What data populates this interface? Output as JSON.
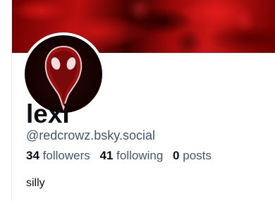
{
  "profile": {
    "display_name": "lexi",
    "handle": "@redcrowz.bsky.social",
    "bio": "silly",
    "avatar_icon": "plague-mask-avatar",
    "banner_icon": "red-smoke-banner"
  },
  "stats": {
    "followers_count": "34",
    "followers_label": "followers",
    "following_count": "41",
    "following_label": "following",
    "posts_count": "0",
    "posts_label": "posts"
  },
  "colors": {
    "text_primary": "#0b0f14",
    "text_secondary": "#42576c",
    "banner_red": "#b80e0e",
    "border": "#e6e9ee"
  }
}
